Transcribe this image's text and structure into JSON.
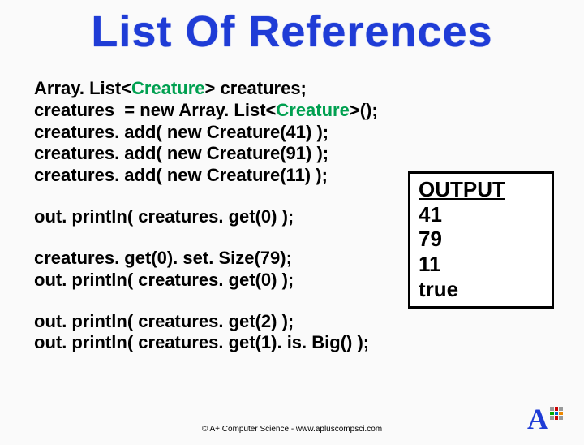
{
  "title": "List Of References",
  "code": {
    "l1a": "Array. List<",
    "l1b": "Creature",
    "l1c": "> creatures;",
    "l2a": "creatures  = new Array. List<",
    "l2b": "Creature",
    "l2c": ">();",
    "l3": "creatures. add( new Creature(41) );",
    "l4": "creatures. add( new Creature(91) );",
    "l5": "creatures. add( new Creature(11) );",
    "l6": "out. println( creatures. get(0) );",
    "l7": "creatures. get(0). set. Size(79);",
    "l8": "out. println( creatures. get(0) );",
    "l9": "out. println( creatures. get(2) );",
    "l10": "out. println( creatures. get(1). is. Big() );"
  },
  "output": {
    "header": "OUTPUT",
    "v1": "41",
    "v2": "79",
    "v3": "11",
    "v4": "true"
  },
  "footer": "© A+ Computer Science  -  www.apluscompsci.com",
  "logo": {
    "letter": "A"
  }
}
